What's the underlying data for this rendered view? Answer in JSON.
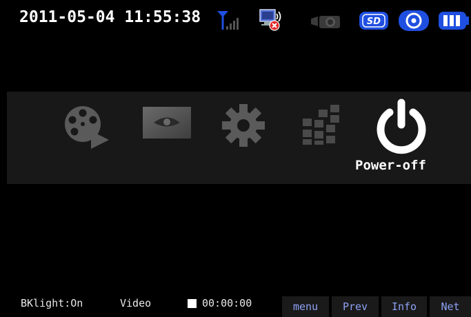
{
  "status_bar": {
    "datetime": "2011-05-04 11:55:38",
    "icons": [
      "signal-antenna-icon",
      "network-disconnected-icon",
      "camera-icon",
      "sd-card-icon",
      "recording-disc-icon",
      "battery-icon"
    ],
    "sd_label": "SD"
  },
  "menu": {
    "items": [
      {
        "name": "video-playback-icon",
        "label": ""
      },
      {
        "name": "preview-eye-icon",
        "label": ""
      },
      {
        "name": "settings-gear-icon",
        "label": ""
      },
      {
        "name": "grid-blocks-icon",
        "label": ""
      },
      {
        "name": "power-icon",
        "label": "Power-off"
      }
    ],
    "selected_label": "Power-off"
  },
  "bottom_bar": {
    "backlight": "BKlight:On",
    "mode": "Video",
    "timer": "00:00:00",
    "softkeys": [
      "menu",
      "Prev",
      "Info",
      "Net"
    ]
  },
  "colors": {
    "accent_blue": "#1f4fe0",
    "softkey_text": "#8ea2f5",
    "band_bg": "#181818",
    "icon_gray": "#555555"
  }
}
